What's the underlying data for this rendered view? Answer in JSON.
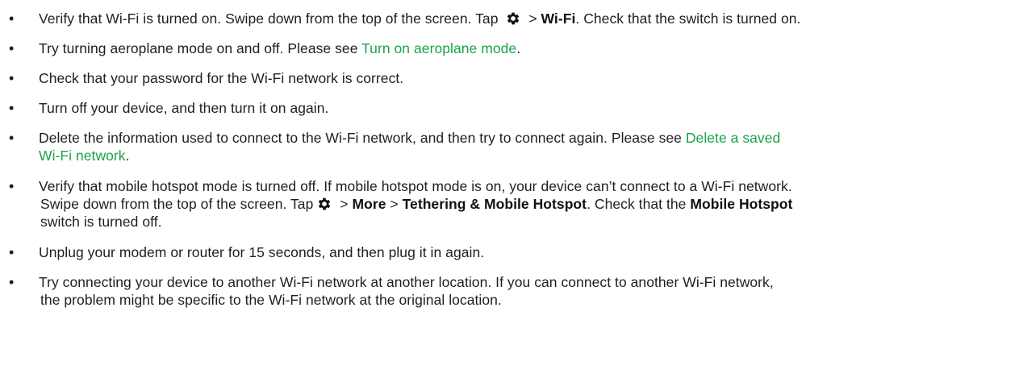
{
  "bullet_symbol": "•",
  "colors": {
    "text": "#1f1f1f",
    "link": "#1aa34a"
  },
  "icons": {
    "settings": "gear-icon"
  },
  "tips": {
    "t1": {
      "a": "Verify that Wi-Fi is turned on. Swipe down from the top of the screen. Tap",
      "b": " > ",
      "c": "Wi-Fi",
      "d": ". Check that the switch is turned on."
    },
    "t2": {
      "a": "Try turning aeroplane mode on and off. Please see ",
      "link": "Turn on aeroplane mode",
      "b": "."
    },
    "t3": {
      "a": "Check that your password for the Wi-Fi network is correct."
    },
    "t4": {
      "a": "Turn off your device, and then turn it on again."
    },
    "t5": {
      "a": "Delete the information used to connect to the Wi-Fi network, and then try to connect again. Please see ",
      "link1": "Delete a saved",
      "link2": "Wi-Fi network",
      "b": "."
    },
    "t6": {
      "a": "Verify that mobile hotspot mode is turned off. If mobile hotspot mode is on, your device can’t connect to a Wi-Fi network.",
      "b": "Swipe down from the top of the screen. Tap",
      "c": " > ",
      "d": "More",
      "e": " > ",
      "f": "Tethering & Mobile Hotspot",
      "g": ". Check that the ",
      "h": "Mobile Hotspot",
      "i": "switch is turned off."
    },
    "t7": {
      "a": "Unplug your modem or router for 15 seconds, and then plug it in again."
    },
    "t8": {
      "a": "Try connecting your device to another Wi-Fi network at another location. If you can connect to another Wi-Fi network,",
      "b": "the problem might be specific to the Wi-Fi network at the original location."
    }
  }
}
